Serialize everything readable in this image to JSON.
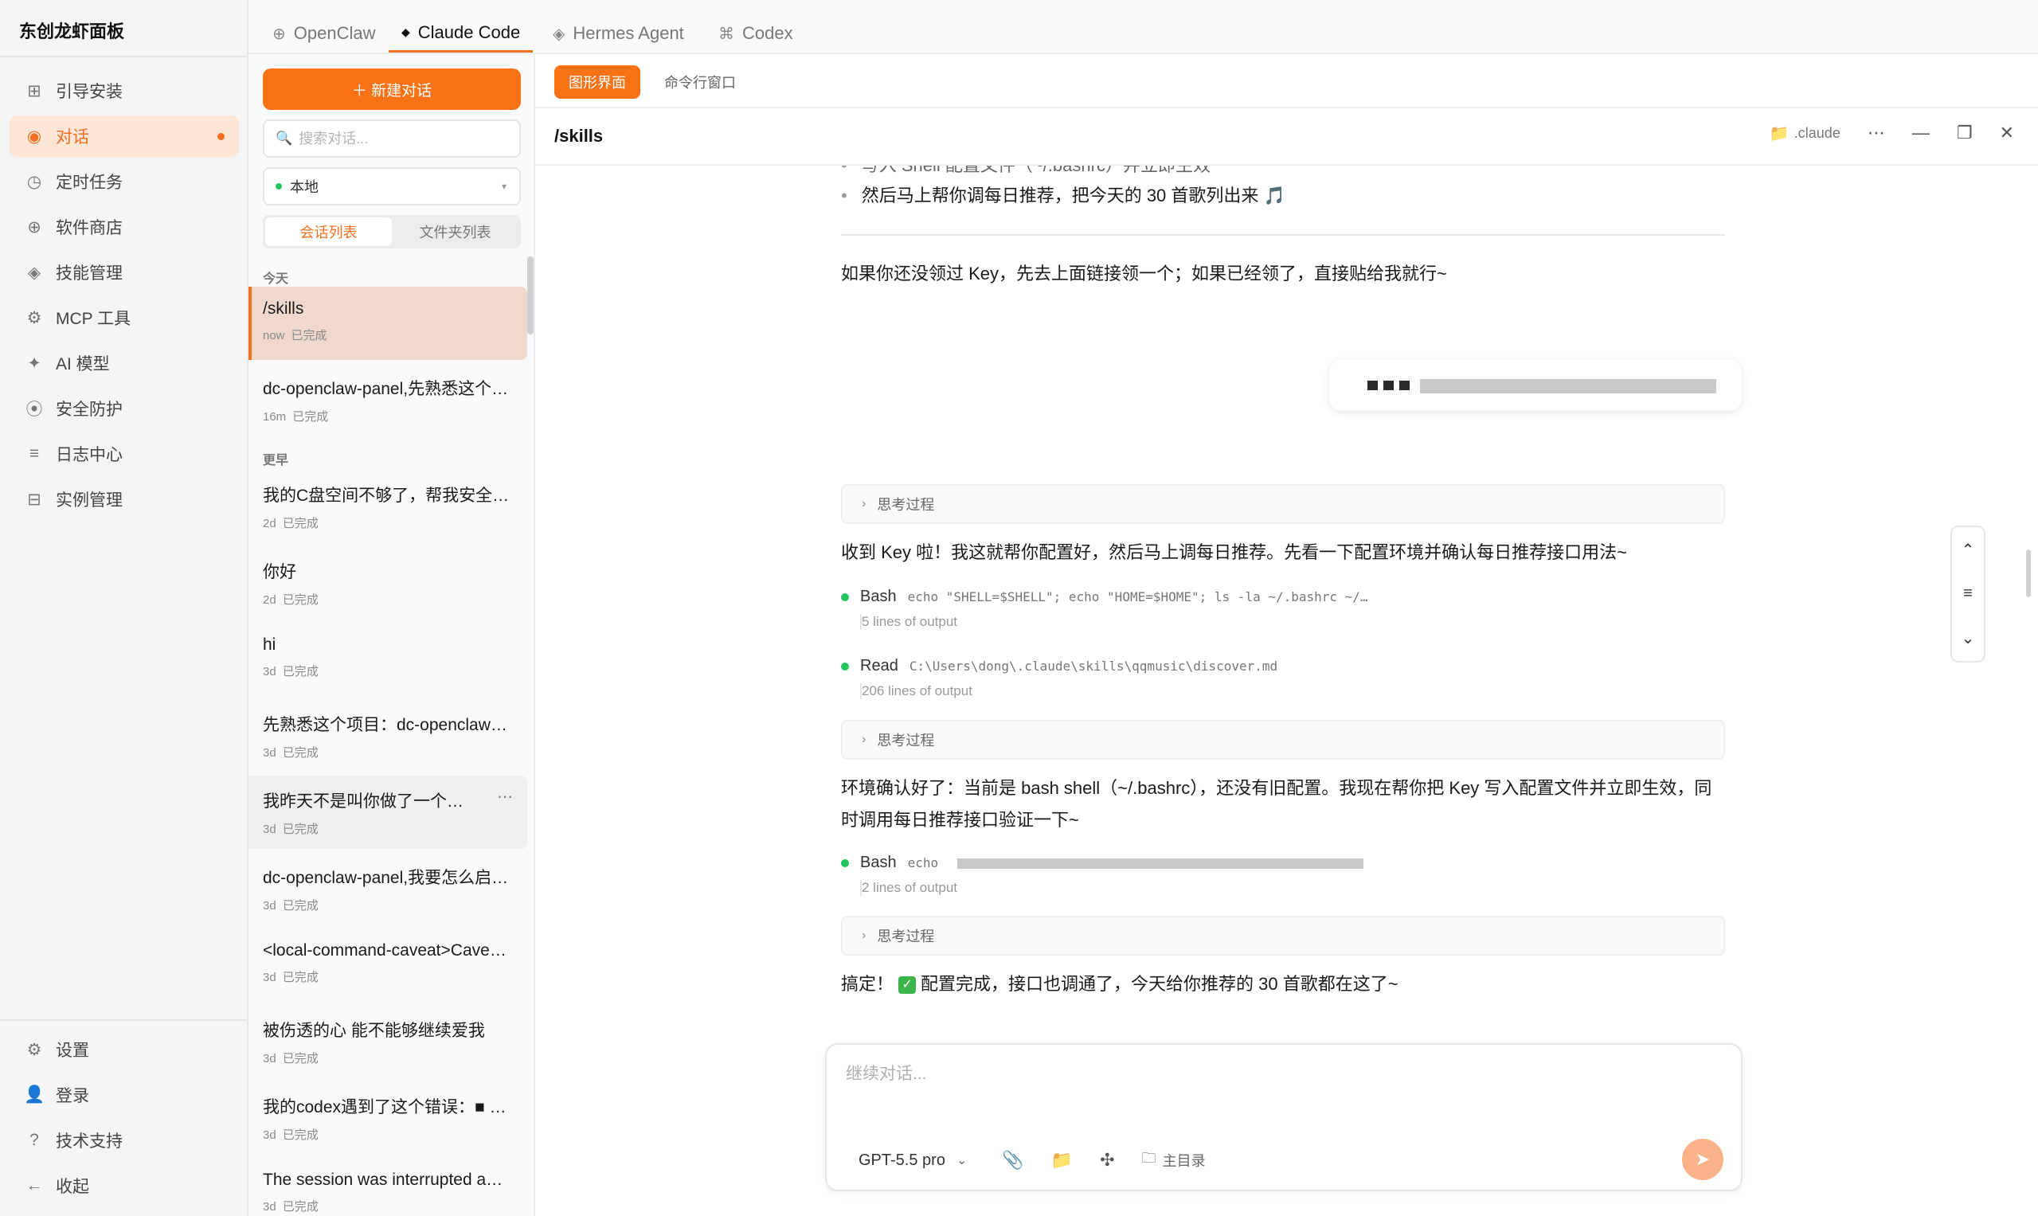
{
  "app": {
    "title": "东创龙虾面板"
  },
  "sidebar": {
    "items": [
      {
        "icon": "grid-icon",
        "glyph": "⊞",
        "label": "引导安装"
      },
      {
        "icon": "chat-icon",
        "glyph": "◉",
        "label": "对话",
        "active": true
      },
      {
        "icon": "clock-icon",
        "glyph": "◷",
        "label": "定时任务"
      },
      {
        "icon": "store-icon",
        "glyph": "⊕",
        "label": "软件商店"
      },
      {
        "icon": "skills-icon",
        "glyph": "◈",
        "label": "技能管理"
      },
      {
        "icon": "tool-icon",
        "glyph": "⚙",
        "label": "MCP 工具"
      },
      {
        "icon": "ai-model-icon",
        "glyph": "✦",
        "label": "AI 模型"
      },
      {
        "icon": "shield-icon",
        "glyph": "⦿",
        "label": "安全防护"
      },
      {
        "icon": "log-icon",
        "glyph": "≡",
        "label": "日志中心"
      },
      {
        "icon": "instance-icon",
        "glyph": "⊟",
        "label": "实例管理"
      }
    ],
    "bottom": [
      {
        "icon": "settings-icon",
        "glyph": "⚙",
        "label": "设置"
      },
      {
        "icon": "user-icon",
        "glyph": "👤",
        "label": "登录"
      },
      {
        "icon": "help-icon",
        "glyph": "?",
        "label": "技术支持"
      },
      {
        "icon": "collapse-icon",
        "glyph": "←",
        "label": "收起"
      }
    ]
  },
  "top_tabs": [
    {
      "icon": "openclaw-icon",
      "glyph": "⊕",
      "label": "OpenClaw"
    },
    {
      "icon": "claude-icon",
      "glyph": "◆",
      "label": "Claude Code",
      "active": true
    },
    {
      "icon": "hermes-icon",
      "glyph": "◈",
      "label": "Hermes Agent"
    },
    {
      "icon": "codex-icon",
      "glyph": "⌘",
      "label": "Codex"
    }
  ],
  "conv_panel": {
    "new_chat": "＋ 新建对话",
    "search_placeholder": "搜索对话...",
    "env": "本地",
    "seg": [
      "会话列表",
      "文件夹列表"
    ],
    "group_today": "今天",
    "group_earlier": "更早",
    "today": [
      {
        "title": "/skills",
        "time": "now",
        "status": "已完成"
      },
      {
        "title": "dc-openclaw-panel,先熟悉这个项目",
        "time": "16m",
        "status": "已完成"
      }
    ],
    "earlier": [
      {
        "title": "我的C盘空间不够了，帮我安全清理一下",
        "time": "2d",
        "status": "已完成"
      },
      {
        "title": "你好",
        "time": "2d",
        "status": "已完成"
      },
      {
        "title": "hi",
        "time": "3d",
        "status": "已完成"
      },
      {
        "title": "先熟悉这个项目：dc-openclaw-panel",
        "time": "3d",
        "status": "已完成"
      },
      {
        "title": "我昨天不是叫你做了一个音乐播放器",
        "time": "3d",
        "status": "已完成"
      },
      {
        "title": "dc-openclaw-panel,我要怎么启动它",
        "time": "3d",
        "status": "已完成"
      },
      {
        "title": "<local-command-caveat>Caveat: The messages",
        "time": "3d",
        "status": "已完成"
      },
      {
        "title": "被伤透的心 能不能够继续爱我",
        "time": "3d",
        "status": "已完成"
      },
      {
        "title": "我的codex遇到了这个错误：■ stream error",
        "time": "3d",
        "status": "已完成"
      },
      {
        "title": "The session was interrupted and resumed",
        "time": "3d",
        "status": "已完成"
      }
    ]
  },
  "modes": [
    "图形界面",
    "命令行窗口"
  ],
  "session": {
    "title": "/skills",
    "folder": ".claude"
  },
  "chat": {
    "bullet_partial": "写入 Shell 配置文件（~/.bashrc）并立即生效",
    "bullet_2": "然后马上帮你调每日推荐，把今天的 30 首歌列出来 🎵",
    "msg_1": "如果你还没领过 Key，先去上面链接领一个；如果已经领了，直接贴给我就行~",
    "think_label": "思考过程",
    "msg_2": "收到 Key 啦！我这就帮你配置好，然后马上调每日推荐。先看一下配置环境并确认每日推荐接口用法~",
    "tool_1": {
      "name": "Bash",
      "cmd": "echo \"SHELL=$SHELL\"; echo \"HOME=$HOME\"; ls -la ~/.bashrc ~/…",
      "sub": "5 lines of output"
    },
    "tool_2": {
      "name": "Read",
      "cmd": "C:\\Users\\dong\\.claude\\skills\\qqmusic\\discover.md",
      "sub": "206 lines of output"
    },
    "msg_3": "环境确认好了：当前是 bash shell（~/.bashrc），还没有旧配置。我现在帮你把 Key 写入配置文件并立即生效，同时调用每日推荐接口验证一下~",
    "tool_3": {
      "name": "Bash",
      "cmd": "echo",
      "sub": "2 lines of output"
    },
    "msg_4_a": "搞定！",
    "msg_4_b": "配置完成，接口也调通了，今天给你推荐的 30 首歌都在这了~"
  },
  "composer": {
    "placeholder": "继续对话...",
    "model": "GPT-5.5 pro",
    "dir": "主目录"
  }
}
